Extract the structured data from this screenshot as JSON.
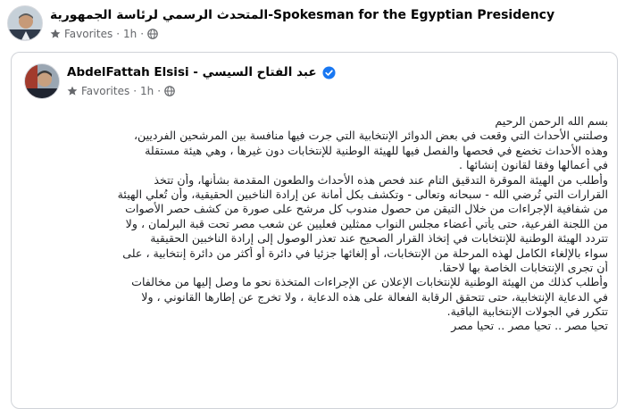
{
  "outer_post": {
    "author": "المتحدث الرسمي لرئاسة الجمهورية-Spokesman for the Egyptian Presidency",
    "audience": "Favorites",
    "separator": "·",
    "time": "1h",
    "avatar_icon": "profile-photo-icon",
    "audience_icon": "star-icon",
    "privacy_icon": "globe-icon"
  },
  "shared_post": {
    "author": "AbdelFattah Elsisi - عبد الفتاح السيسي",
    "audience": "Favorites",
    "separator": "·",
    "time": "1h",
    "verified_icon": "verified-badge-icon",
    "verified_color": "#1877f2",
    "lines": [
      "بسم الله الرحمن الرحيم",
      "وصلتني الأحداث التي وقعت في بعض الدوائر الإنتخابية التي جرت فيها منافسة بين المرشحين الفرديين،",
      "وهذه الأحداث تخضع في فحصها والفصل فيها للهيئة الوطنية للإنتخابات دون غيرها ، وهي هيئة مستقلة",
      "في أعمالها وفقا لقانون إنشائها .",
      "وأطلب من الهيئة الموقرة التدقيق التام عند فحص هذه الأحداث والطعون المقدمة بشأنها، وأن تتخذ",
      "القرارات التي تُرضي الله - سبحانه وتعالى - وتكشف بكل أمانة عن إرادة الناخبين الحقيقية، وأن تُعلي الهيئة",
      "من شفافية الإجراءات من خلال التيقن من حصول مندوب كل مرشح على صورة من كشف حصر الأصوات",
      "من اللجنة الفرعية، حتى يأتي أعضاء مجلس النواب ممثلين فعليين عن شعب مصر تحت قبة البرلمان ، ولا",
      "تتردد الهيئة الوطنية للإنتخابات في إتخاذ القرار الصحيح عند تعذر الوصول إلى إرادة الناخبين الحقيقية",
      "سواء بالإلغاء الكامل لهذه المرحلة من الإنتخابات، أو إلغائها جزئيا في دائرة أو أكثر من دائرة إنتخابية ، على",
      "أن تجرى الإنتخابات الخاصة بها لاحقا.",
      "وأطلب كذلك من الهيئة الوطنية للإنتخابات الإعلان عن الإجراءات المتخذة نحو ما وصل إليها من مخالفات",
      "في الدعاية الإنتخابية، حتى تتحقق الرقابة الفعالة على هذه الدعاية ، ولا تخرج عن إطارها القانوني ، ولا",
      "تتكرر في الجولات الإنتخابية الباقية.",
      "تحيا مصر .. تحيا مصر .. تحيا مصر"
    ]
  }
}
